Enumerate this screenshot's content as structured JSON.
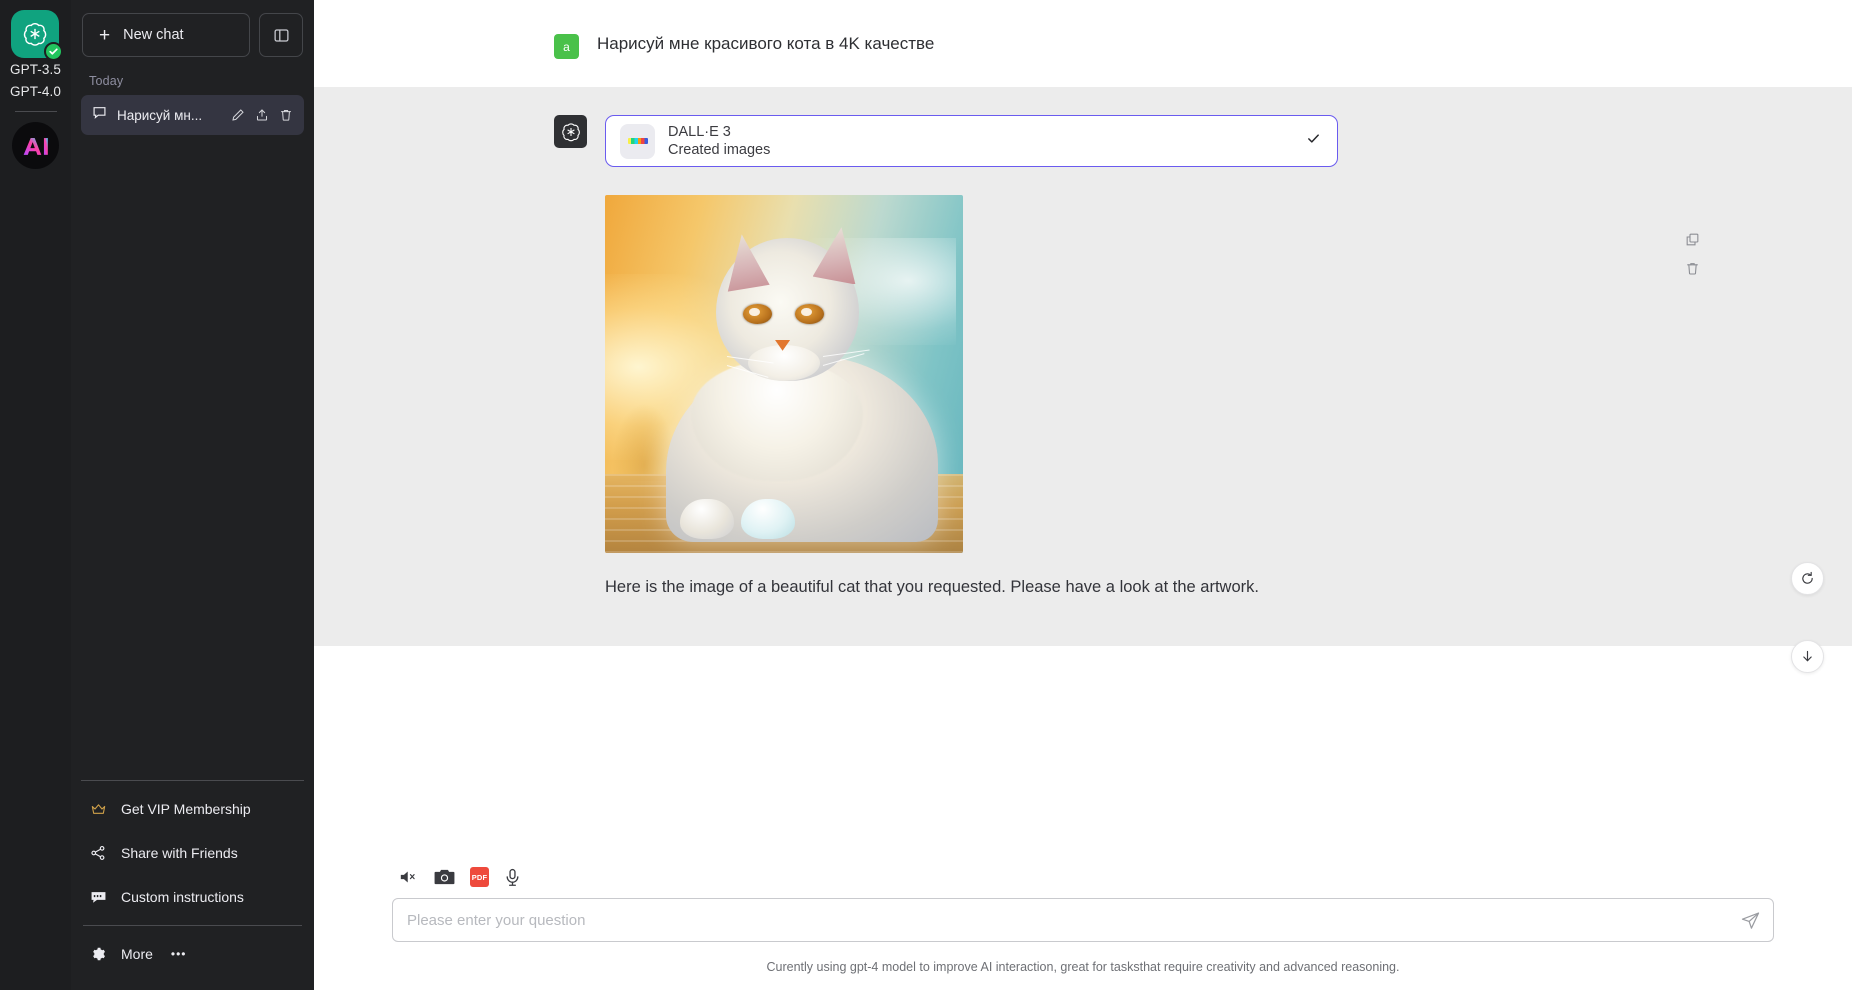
{
  "rail": {
    "logo_icon": "openai-logo-icon",
    "active_check_icon": "check-badge-icon",
    "model_primary": "GPT-3.5",
    "model_secondary": "GPT-4.0",
    "ai_badge_text": "AI",
    "ai_badge_icon": "ai-avatar-icon"
  },
  "sidebar": {
    "new_chat_label": "New chat",
    "new_chat_icon": "plus-icon",
    "toggle_icon": "sidebar-toggle-icon",
    "section_label": "Today",
    "chats": [
      {
        "icon": "chat-bubble-icon",
        "title": "Нарисуй мн...",
        "actions": [
          "edit-pencil-icon",
          "share-upload-icon",
          "trash-icon"
        ]
      }
    ],
    "menu": [
      {
        "icon": "crown-icon",
        "label": "Get VIP Membership"
      },
      {
        "icon": "share-nodes-icon",
        "label": "Share with Friends"
      },
      {
        "icon": "speech-bubble-icon",
        "label": "Custom instructions"
      },
      {
        "icon": "gear-icon",
        "label": "More",
        "suffix": "•••"
      }
    ]
  },
  "conversation": {
    "user": {
      "avatar_letter": "a",
      "avatar_color": "#4ac14a",
      "text": "Нарисуй мне красивого кота в 4K качестве"
    },
    "assistant": {
      "avatar_icon": "openai-logo-icon",
      "tool_card": {
        "thumb_icon": "dalle-gradient-icon",
        "title": "DALL·E 3",
        "subtitle": "Created images",
        "status_icon": "checkmark-icon",
        "border_color": "#6a5bef"
      },
      "image": {
        "alt": "A fluffy long-haired white and grey cat lying on a wooden deck at sunset",
        "icon": "generated-image"
      },
      "text": "Here is the image of a beautiful cat that you requested. Please have a look at the artwork."
    },
    "side_actions": [
      "copy-icon",
      "trash-icon"
    ],
    "float_actions": [
      "regenerate-icon",
      "scroll-to-bottom-icon"
    ]
  },
  "composer": {
    "tools": [
      {
        "icon": "speaker-muted-icon"
      },
      {
        "icon": "camera-icon"
      },
      {
        "icon": "pdf-icon",
        "label": "PDF"
      },
      {
        "icon": "microphone-icon"
      }
    ],
    "placeholder": "Please enter your question",
    "value": "",
    "send_icon": "send-paper-plane-icon"
  },
  "footer": {
    "note": "Curently using gpt-4 model to improve AI interaction, great for tasksthat require creativity and advanced reasoning."
  }
}
